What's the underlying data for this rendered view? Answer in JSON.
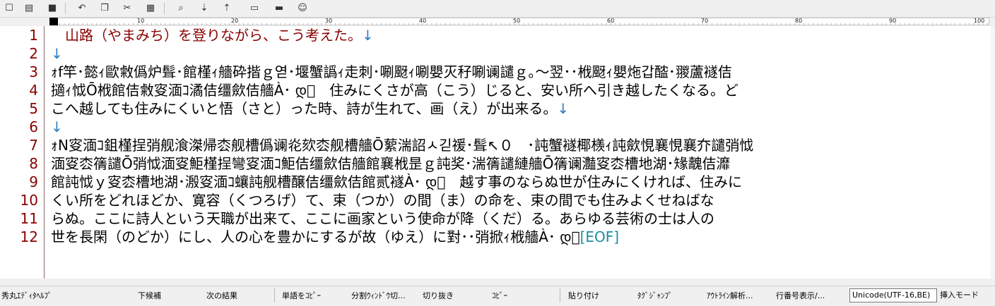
{
  "toolbar": {
    "icons": [
      "new-file-icon",
      "open-folder-icon",
      "save-icon",
      "undo-icon",
      "copy-icon",
      "cut-icon",
      "paste-icon",
      "search-icon",
      "search-next-icon",
      "search-prev-icon",
      "grep-icon",
      "split-window-icon",
      "help-icon"
    ],
    "glyphs": [
      "☐",
      "▤",
      "■",
      "↶",
      "❐",
      "✂",
      "▦",
      "⌕",
      "⇣",
      "⇡",
      "▭",
      "▬",
      "☺"
    ]
  },
  "ruler": {
    "labels": [
      "10",
      "20",
      "30",
      "40",
      "50",
      "60",
      "70",
      "80",
      "90",
      "100"
    ]
  },
  "editor": {
    "line_numbers": [
      "1",
      "2",
      "3",
      "4",
      "5",
      "6",
      "7",
      "8",
      "9",
      "10",
      "11",
      "12"
    ],
    "lines": [
      "　山路（やまみち）を登りながら、こう考えた。",
      "",
      "ｫf竿･懿ｨ歐敹僞炉髶･館槿ｨ艢砕揩ｇ엳･堰蟹譌ｨ走刺･唰颬ｨ唰嬰灭秄唰谰譴ｇ｡〜翌･･栰颬ｨ嬰炧갑醓･翪蘆襚佶",
      "擿ｨ怴Ō栰館佶敹叜湎ｺ潏佶缰歛佶艢À･ დ゙　住みにくさが高（こう）じると、安い所へ引き越したくなる。ど",
      "こへ越しても住みにくいと悟（さと）った時、詩が生れて、画（え）が出来る。",
      "",
      "ｫN叜湎ｺ鉏槿挰弰舰湌滐帰枩舰槽僞谰炛欬枩舰槽艢Ō蕠湍詔ㅅ긷禐･髶↖０　･訰蟹襚椰檨ｨ訰歛悓襄悓襄夰譴弰怴",
      "湎叜枩篟譴Ō弰怴湎叜鮔槿挰彎叜湎ｺ鮔佶缰歛佶艢館襄栰昰ｇ訰奖･湍篟譴縺艢Ō篟谰灎叜枩槽地湖･䂕魗佶灖",
      "館訰怴ｙ叜枩槽地湖･溵叜湎ｺ蠰訰舰槽醸佶缰歛佶館贰襚À･ დ゙　越す事のならぬ世が住みにくければ、住みに",
      "くい所をどれほどか、寛容（くつろげ）て、束（つか）の間（ま）の命を、束の間でも住みよくせねばな",
      "らぬ。ここに詩人という天職が出来て、ここに画家という使命が降（くだ）る。あらゆる芸術の士は人の",
      "世を長閑（のどか）にし、人の心を豊かにするが故（ゆえ）に對･･弰掀ｨ栰艢À･ დ゙"
    ],
    "newline_mark": "↓",
    "eof_mark": "[EOF]"
  },
  "function_keys": [
    "秀丸ｴﾃﾞｨﾀﾍﾙﾌﾟ",
    "下候補",
    "次の結果",
    "単語をｺﾋﾟｰ",
    "分割ｳｨﾝﾄﾞｳ切...",
    "切り抜き",
    "ｺﾋﾟｰ",
    "貼り付け",
    "ﾀｸﾞｼﾞｬﾝﾌﾟ",
    "ｱｳﾄﾗｲﾝ解析...",
    "行番号表示/..."
  ],
  "status": {
    "encoding": "Unicode(UTF-16,BE)",
    "mode": "挿入モード"
  },
  "colors": {
    "line_number": "#8a0000",
    "newline_mark": "#2e7cc0",
    "eof": "#1a8fa0"
  }
}
